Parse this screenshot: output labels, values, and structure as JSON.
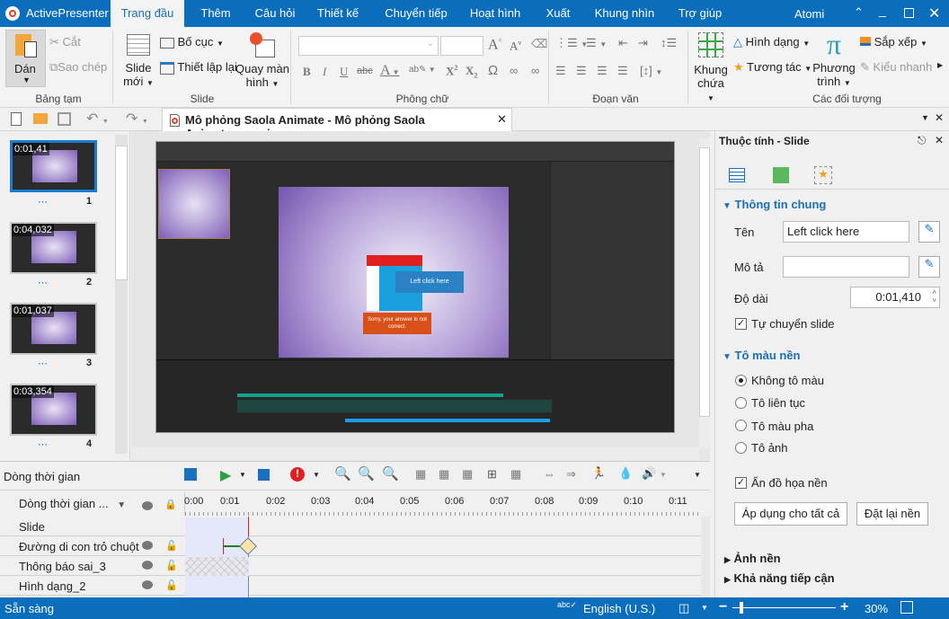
{
  "app": {
    "name": "ActivePresenter",
    "user": "Atomi",
    "accent": "#0b6ebd"
  },
  "tabs": [
    "Trang đầu",
    "Thêm",
    "Câu hỏi",
    "Thiết kế",
    "Chuyển tiếp",
    "Hoạt hình",
    "Xuất",
    "Khung nhìn",
    "Trợ giúp"
  ],
  "active_tab": "Trang đầu",
  "ribbon": {
    "clipboard": {
      "label": "Bảng tạm",
      "paste": "Dán",
      "cut": "Cắt",
      "copy": "Sao chép"
    },
    "slide": {
      "label": "Slide",
      "new_slide": "Slide",
      "new_slide2": "mới",
      "layout": "Bố cục",
      "reset": "Thiết lập lại",
      "record": "Quay màn",
      "record2": "hình"
    },
    "font": {
      "label": "Phông chữ"
    },
    "paragraph": {
      "label": "Đoạn văn"
    },
    "objects": {
      "label": "Các đối tượng",
      "container": "Khung",
      "container2": "chứa",
      "shape": "Hình dạng",
      "interaction": "Tương tác",
      "equation": "Phương",
      "equation2": "trình",
      "arrange": "Sắp xếp",
      "quick_style": "Kiểu nhanh"
    }
  },
  "document_tab": "Mô phỏng Saola Animate - Mô phỏng Saola Animate.approj",
  "slides": [
    {
      "duration": "0:01,41",
      "number": "1",
      "selected": true
    },
    {
      "duration": "0:04,032",
      "number": "2"
    },
    {
      "duration": "0:01,037",
      "number": "3"
    },
    {
      "duration": "0:03,354",
      "number": "4"
    }
  ],
  "slide_content": {
    "callout": "Left click here",
    "feedback": "Sorry, your answer is not correct."
  },
  "properties": {
    "title": "Thuộc tính - Slide",
    "general": {
      "header": "Thông tin chung",
      "name_label": "Tên",
      "name_value": "Left click here",
      "desc_label": "Mô tả",
      "desc_value": "",
      "duration_label": "Độ dài",
      "duration_value": "0:01,410",
      "auto_advance": "Tự chuyển slide",
      "auto_advance_checked": true
    },
    "fill": {
      "header": "Tô màu nền",
      "options": [
        "Không tô màu",
        "Tô liên tục",
        "Tô màu pha",
        "Tô ảnh"
      ],
      "selected": "Không tô màu",
      "hide_bg": "Ẩn đồ họa nền",
      "hide_bg_checked": true,
      "apply_all": "Áp dụng cho tất cả",
      "reset_bg": "Đặt lại nền"
    },
    "bg_image": "Ảnh nền",
    "accessibility": "Khả năng tiếp cận"
  },
  "timeline": {
    "title": "Dòng thời gian",
    "selector": "Dòng thời gian ...",
    "ticks": [
      "0:00",
      "0:01",
      "0:02",
      "0:03",
      "0:04",
      "0:05",
      "0:06",
      "0:07",
      "0:08",
      "0:09",
      "0:10",
      "0:11"
    ],
    "rows": [
      "Slide",
      "Đường di con trỏ chuột",
      "Thông báo sai_3",
      "Hình dạng_2"
    ]
  },
  "status": {
    "text": "Sẵn sàng",
    "language": "English (U.S.)",
    "zoom": "30%"
  }
}
